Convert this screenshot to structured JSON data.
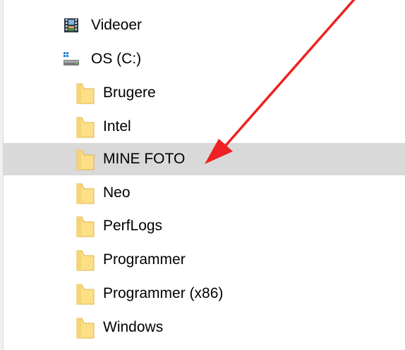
{
  "colors": {
    "selection": "#d9d9d9",
    "folder": "#fce087",
    "folder_edge": "#e8b84a",
    "arrow": "#ee2222"
  },
  "tree": {
    "items": [
      {
        "label": "Videoer",
        "icon": "video-icon",
        "selected": false
      },
      {
        "label": "OS (C:)",
        "icon": "drive-icon",
        "selected": false
      },
      {
        "label": "Brugere",
        "icon": "folder-icon",
        "selected": false
      },
      {
        "label": "Intel",
        "icon": "folder-icon",
        "selected": false
      },
      {
        "label": "MINE FOTO",
        "icon": "folder-icon",
        "selected": true
      },
      {
        "label": "Neo",
        "icon": "folder-icon",
        "selected": false
      },
      {
        "label": "PerfLogs",
        "icon": "folder-icon",
        "selected": false
      },
      {
        "label": "Programmer",
        "icon": "folder-icon",
        "selected": false
      },
      {
        "label": "Programmer (x86)",
        "icon": "folder-icon",
        "selected": false
      },
      {
        "label": "Windows",
        "icon": "folder-icon",
        "selected": false
      }
    ]
  },
  "annotation": {
    "icon": "red-arrow-icon"
  }
}
